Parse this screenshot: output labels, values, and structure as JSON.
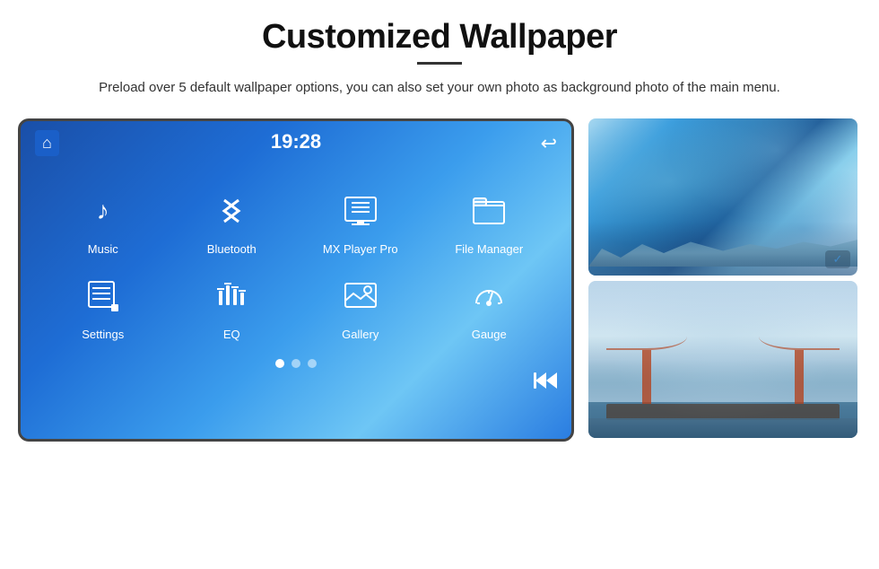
{
  "header": {
    "title": "Customized Wallpaper",
    "description": "Preload over 5 default wallpaper options, you can also set your own photo as background photo of the main menu."
  },
  "screen": {
    "time": "19:28",
    "icons_row1": [
      {
        "label": "Music",
        "icon": "♪"
      },
      {
        "label": "Bluetooth",
        "icon": "⊕"
      },
      {
        "label": "MX Player Pro",
        "icon": "▦"
      },
      {
        "label": "File Manager",
        "icon": "📁"
      }
    ],
    "icons_row2": [
      {
        "label": "Settings",
        "icon": "⚙"
      },
      {
        "label": "EQ",
        "icon": "≡"
      },
      {
        "label": "Gallery",
        "icon": "🖼"
      },
      {
        "label": "Gauge",
        "icon": "◎"
      }
    ],
    "dots": [
      true,
      false,
      false
    ]
  },
  "thumbnails": [
    {
      "alt": "Ice cave wallpaper"
    },
    {
      "alt": "Golden Gate Bridge wallpaper"
    }
  ]
}
